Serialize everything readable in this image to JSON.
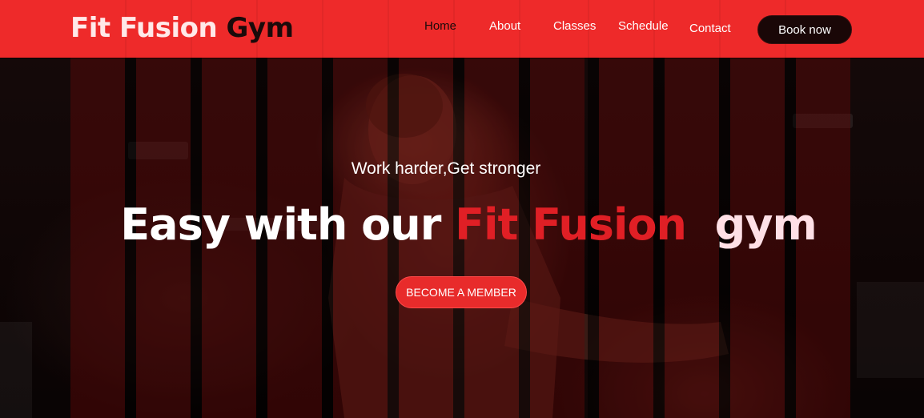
{
  "brand": {
    "name_part1": "Fit Fusion",
    "name_part2": "Gym"
  },
  "nav": {
    "items": [
      {
        "label": "Home",
        "active": true
      },
      {
        "label": "About",
        "active": false
      },
      {
        "label": "Classes",
        "active": false
      },
      {
        "label": "Schedule",
        "active": false
      },
      {
        "label": "Contact",
        "active": false
      }
    ],
    "cta_label": "Book now"
  },
  "hero": {
    "tagline": "Work harder,Get stronger",
    "headline_part1": "Easy with our ",
    "headline_highlight": "Fit Fusion",
    "headline_part2": "gym",
    "button_label": "BECOME A MEMBER",
    "background_image": "gym-man-workout-photo"
  },
  "colors": {
    "accent": "#ee2a2a",
    "dark": "#1a0707",
    "highlight_text": "#e01f25"
  }
}
